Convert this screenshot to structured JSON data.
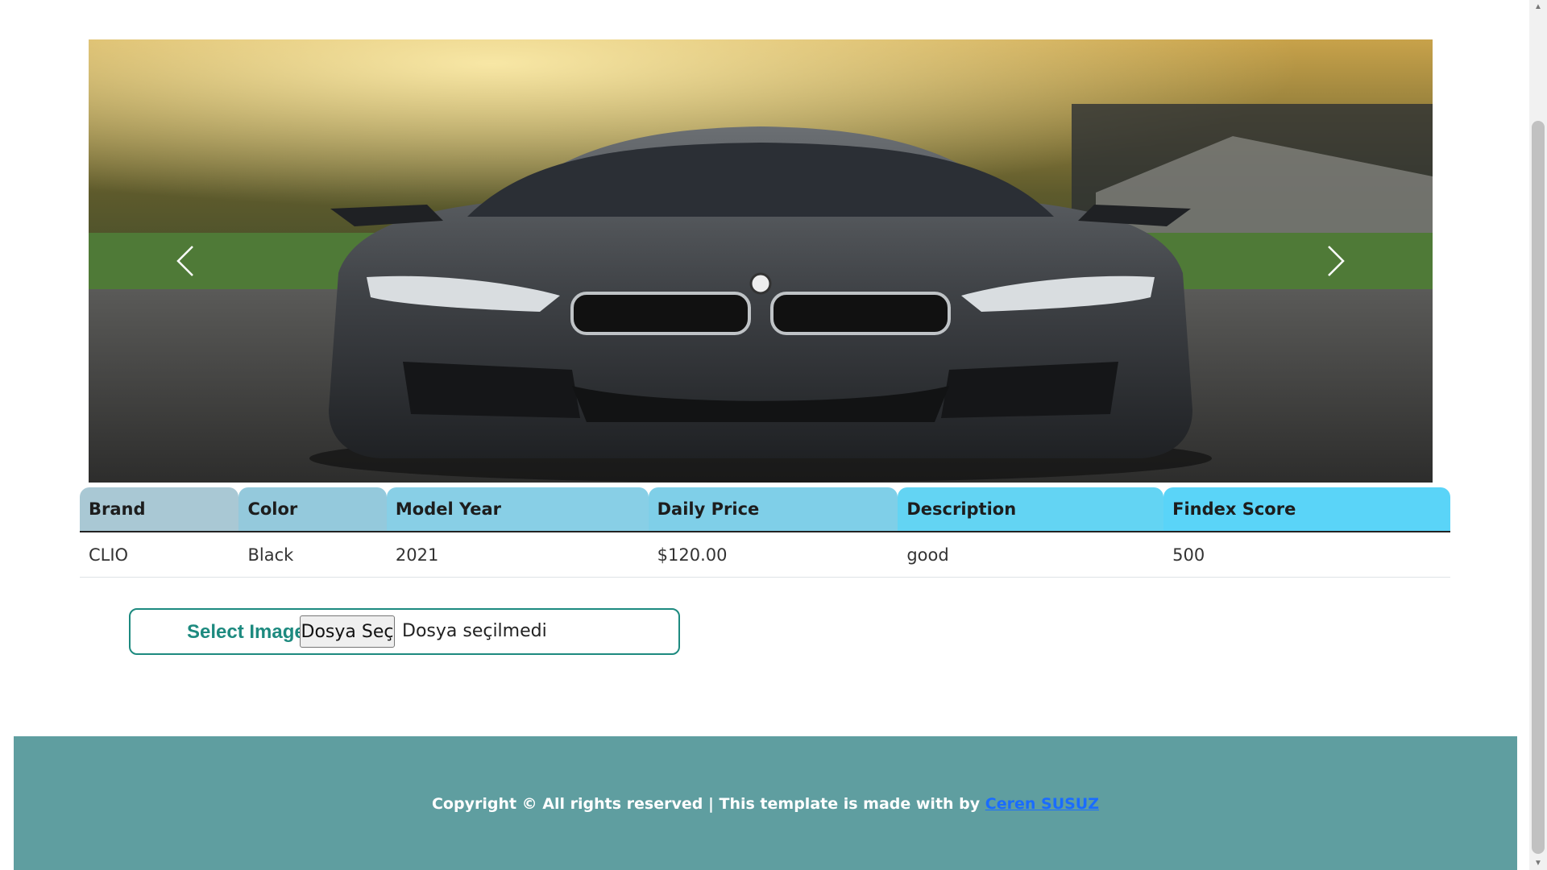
{
  "carousel": {
    "image_alt": "Dark grey BMW sports car front view",
    "prev_icon": "chevron-left-icon",
    "next_icon": "chevron-right-icon"
  },
  "table": {
    "headers": [
      "Brand",
      "Color",
      "Model Year",
      "Daily Price",
      "Description",
      "Findex Score"
    ],
    "header_colors": [
      "#a9c8d4",
      "#94c9dc",
      "#88cfe6",
      "#7fcfe8",
      "#63d4f3",
      "#5ad4f8"
    ],
    "rows": [
      [
        "CLIO",
        "Black",
        "2021",
        "$120.00",
        "good",
        "500"
      ]
    ]
  },
  "upload": {
    "label": "Select Image",
    "button": "Dosya Seç",
    "status": "Dosya seçilmedi"
  },
  "footer": {
    "text": "Copyright © All rights reserved | This template is made with by ",
    "link": "Ceren SUSUZ",
    "color": "#5f9ea0"
  }
}
